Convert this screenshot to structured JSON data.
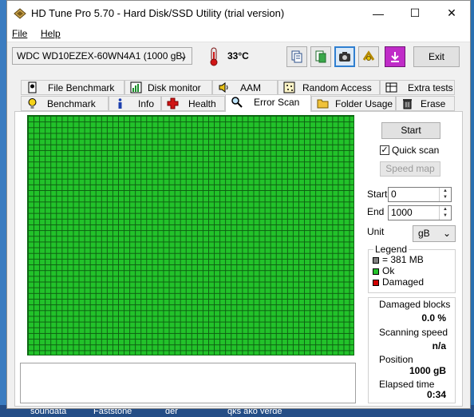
{
  "window": {
    "title": "HD Tune Pro 5.70 - Hard Disk/SSD Utility (trial version)"
  },
  "titlebar_buttons": {
    "minimize": "—",
    "maximize": "☐",
    "close": "✕"
  },
  "menu": [
    "File",
    "Help"
  ],
  "toolbar": {
    "drive": "WDC WD10EZEX-60WN4A1 (1000 gB)",
    "temperature": "33°C",
    "exit_label": "Exit",
    "icons": [
      "copy-icon",
      "save-icon",
      "camera-icon",
      "options-icon",
      "download-icon"
    ]
  },
  "tabs_row1": [
    "File Benchmark",
    "Disk monitor",
    "AAM",
    "Random Access",
    "Extra tests"
  ],
  "tabs_row2": [
    "Benchmark",
    "Info",
    "Health",
    "Error Scan",
    "Folder Usage",
    "Erase"
  ],
  "active_tab": "Error Scan",
  "controls": {
    "start_label": "Start",
    "quick_scan_label": "Quick scan",
    "quick_scan_checked": true,
    "speed_map_label": "Speed map",
    "start_field_label": "Start",
    "start_value": "0",
    "end_field_label": "End",
    "end_value": "1000",
    "unit_label": "Unit",
    "unit_value": "gB"
  },
  "legend": {
    "title": "Legend",
    "items": [
      {
        "label": "= 381 MB",
        "color": "#808080"
      },
      {
        "label": "Ok",
        "color": "#22c22a"
      },
      {
        "label": "Damaged",
        "color": "#d00000"
      }
    ]
  },
  "stats": {
    "damaged_blocks_label": "Damaged blocks",
    "damaged_blocks_value": "0.0 %",
    "scanning_speed_label": "Scanning speed",
    "scanning_speed_value": "n/a",
    "position_label": "Position",
    "position_value": "1000 gB",
    "elapsed_label": "Elapsed time",
    "elapsed_value": "0:34"
  },
  "scan_grid": {
    "status": "Ok",
    "color": "#22c22a"
  },
  "taskbar_labels": [
    "soundata",
    "Faststone",
    "der",
    "qks ako verde"
  ]
}
